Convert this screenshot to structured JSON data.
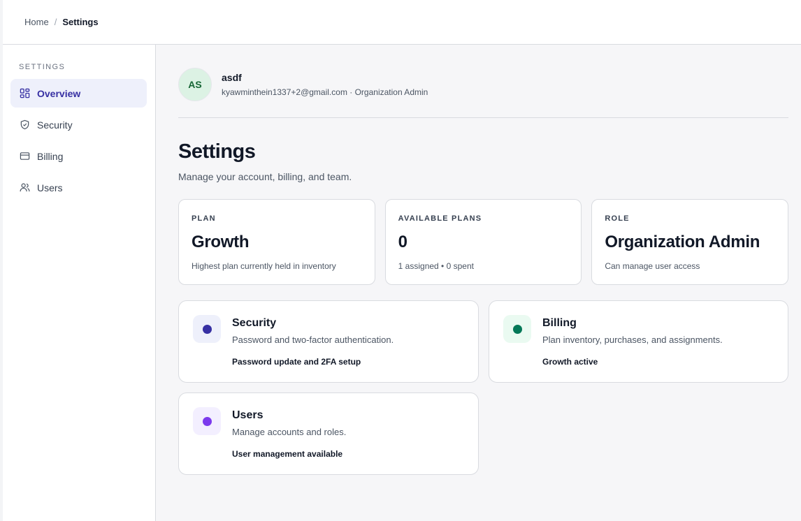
{
  "breadcrumb": {
    "home": "Home",
    "separator": "/",
    "current": "Settings"
  },
  "sidebar": {
    "heading": "SETTINGS",
    "items": [
      {
        "label": "Overview",
        "icon": "grid-icon",
        "active": true
      },
      {
        "label": "Security",
        "icon": "shield-icon",
        "active": false
      },
      {
        "label": "Billing",
        "icon": "card-icon",
        "active": false
      },
      {
        "label": "Users",
        "icon": "users-icon",
        "active": false
      }
    ]
  },
  "profile": {
    "initials": "AS",
    "name": "asdf",
    "meta": "kyawminthein1337+2@gmail.com · Organization Admin"
  },
  "page": {
    "title": "Settings",
    "subtitle": "Manage your account, billing, and team."
  },
  "stats": [
    {
      "label": "PLAN",
      "value": "Growth",
      "desc": "Highest plan currently held in inventory"
    },
    {
      "label": "AVAILABLE PLANS",
      "value": "0",
      "desc": "1 assigned • 0 spent"
    },
    {
      "label": "ROLE",
      "value": "Organization Admin",
      "desc": "Can manage user access"
    }
  ],
  "features": [
    {
      "title": "Security",
      "desc": "Password and two-factor authentication.",
      "status": "Password update and 2FA setup",
      "dot_color": "#3730a3",
      "bg_color": "#eef0fb"
    },
    {
      "title": "Billing",
      "desc": "Plan inventory, purchases, and assignments.",
      "status": "Growth active",
      "dot_color": "#047857",
      "bg_color": "#eafaf1"
    },
    {
      "title": "Users",
      "desc": "Manage accounts and roles.",
      "status": "User management available",
      "dot_color": "#7c3aed",
      "bg_color": "#f3efff"
    }
  ],
  "colors": {
    "accent": "#3730a3",
    "active_nav_bg": "#eef0fb",
    "main_bg": "#f6f6f8"
  }
}
